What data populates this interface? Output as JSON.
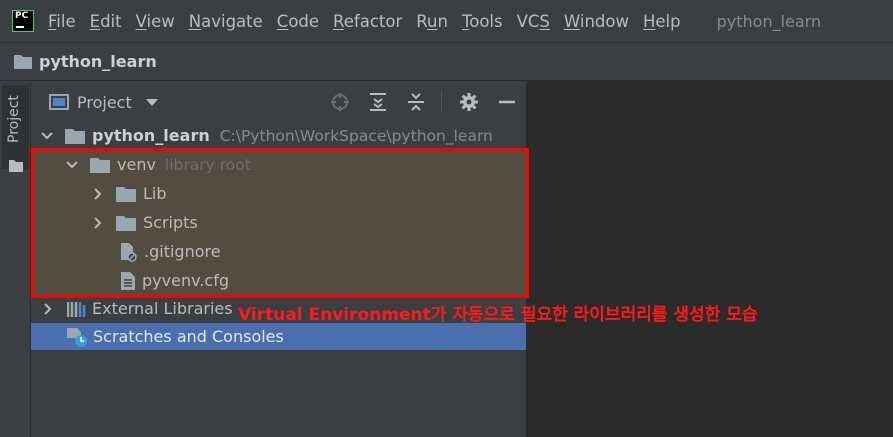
{
  "menubar": {
    "logo_text": "PC",
    "items": [
      {
        "mnemonic": "F",
        "rest": "ile"
      },
      {
        "mnemonic": "E",
        "rest": "dit"
      },
      {
        "mnemonic": "V",
        "rest": "iew"
      },
      {
        "mnemonic": "N",
        "rest": "avigate"
      },
      {
        "mnemonic": "C",
        "rest": "ode"
      },
      {
        "mnemonic": "R",
        "rest": "efactor"
      },
      {
        "pre": "R",
        "mnemonic": "u",
        "rest": "n"
      },
      {
        "mnemonic": "T",
        "rest": "ools"
      },
      {
        "pre": "VC",
        "mnemonic": "S",
        "rest": ""
      },
      {
        "mnemonic": "W",
        "rest": "indow"
      },
      {
        "mnemonic": "H",
        "rest": "elp"
      }
    ],
    "window_title": "python_learn"
  },
  "navbar": {
    "project_name": "python_learn"
  },
  "stripe": {
    "project_tab": "Project"
  },
  "panel": {
    "title": "Project",
    "icons": [
      "locate-icon",
      "expand-all-icon",
      "collapse-all-icon",
      "gear-icon",
      "minimize-icon"
    ]
  },
  "tree": {
    "root": {
      "name": "python_learn",
      "path": "C:\\Python\\WorkSpace\\python_learn"
    },
    "venv": {
      "name": "venv",
      "hint": "library root"
    },
    "lib": "Lib",
    "scripts": "Scripts",
    "gitignore": ".gitignore",
    "pyvenv": "pyvenv.cfg",
    "external": "External Libraries",
    "scratches": "Scratches and Consoles"
  },
  "annotation": "Virtual Environment가 자동으로 필요한 라이브러리를 생성한 모습",
  "colors": {
    "highlight_border": "#ff0000",
    "selection": "#4b6eaf",
    "annotation": "#ff1a1a"
  }
}
